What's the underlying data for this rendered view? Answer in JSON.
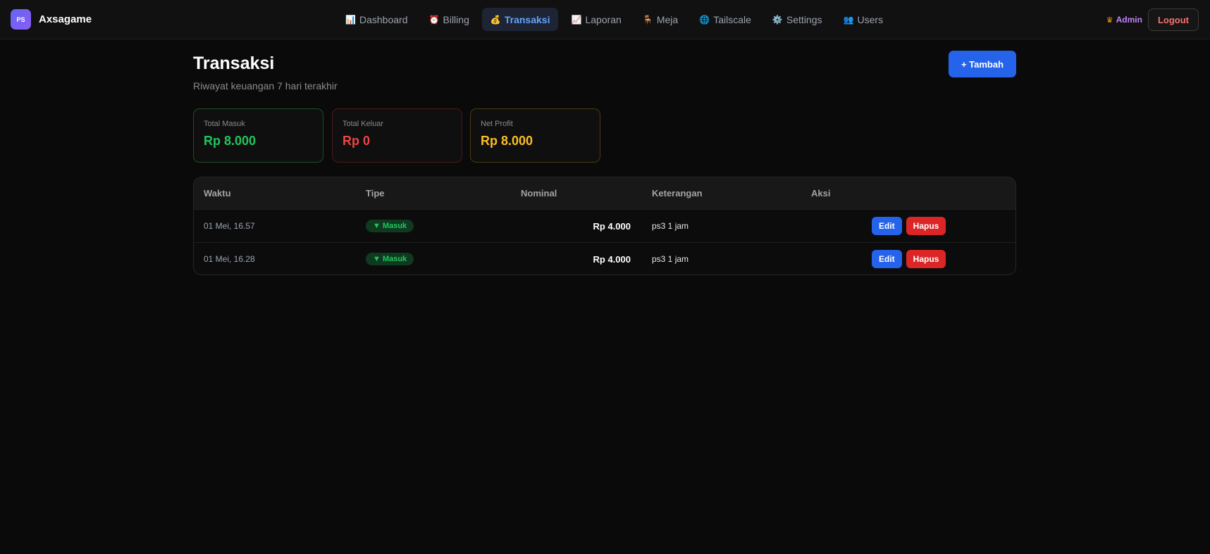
{
  "app": {
    "logo_text": "PS",
    "name": "Axsagame"
  },
  "nav": [
    {
      "icon": "📊",
      "label": "Dashboard",
      "active": false
    },
    {
      "icon": "⏰",
      "label": "Billing",
      "active": false
    },
    {
      "icon": "💰",
      "label": "Transaksi",
      "active": true
    },
    {
      "icon": "📈",
      "label": "Laporan",
      "active": false
    },
    {
      "icon": "🪑",
      "label": "Meja",
      "active": false
    },
    {
      "icon": "🌐",
      "label": "Tailscale",
      "active": false
    },
    {
      "icon": "⚙️",
      "label": "Settings",
      "active": false
    },
    {
      "icon": "👥",
      "label": "Users",
      "active": false
    }
  ],
  "user": {
    "role": "Admin",
    "logout_label": "Logout"
  },
  "page": {
    "title": "Transaksi",
    "subtitle": "Riwayat keuangan 7 hari terakhir",
    "add_label": "+ Tambah"
  },
  "stats": {
    "in": {
      "label": "Total Masuk",
      "value": "Rp 8.000"
    },
    "out": {
      "label": "Total Keluar",
      "value": "Rp 0"
    },
    "profit": {
      "label": "Net Profit",
      "value": "Rp 8.000"
    }
  },
  "table": {
    "headers": [
      "Waktu",
      "Tipe",
      "Nominal",
      "Keterangan",
      "Aksi"
    ],
    "rows": [
      {
        "time": "01 Mei, 16.57",
        "type": "▼ Masuk",
        "nominal": "Rp 4.000",
        "note": "ps3 1 jam",
        "edit": "Edit",
        "delete": "Hapus"
      },
      {
        "time": "01 Mei, 16.28",
        "type": "▼ Masuk",
        "nominal": "Rp 4.000",
        "note": "ps3 1 jam",
        "edit": "Edit",
        "delete": "Hapus"
      }
    ]
  },
  "colors": {
    "accent": "#2563eb",
    "income": "#22c55e",
    "expense": "#ef4444",
    "profit": "#fbbf24",
    "danger": "#dc2626"
  }
}
